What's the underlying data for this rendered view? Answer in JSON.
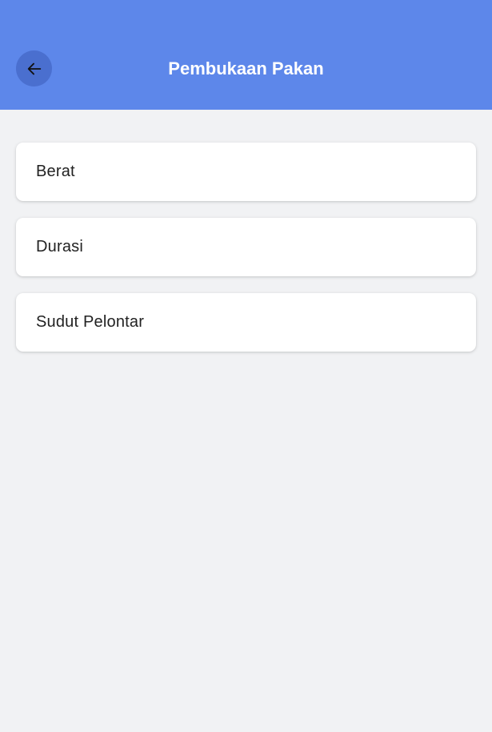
{
  "header": {
    "title": "Pembukaan Pakan",
    "back_icon": "arrow-left-icon",
    "background_color": "#5d87ea",
    "back_button_color": "#4a6fcf"
  },
  "menu": {
    "items": [
      {
        "label": "Berat"
      },
      {
        "label": "Durasi"
      },
      {
        "label": "Sudut Pelontar"
      }
    ]
  },
  "colors": {
    "page_background": "#f1f2f4",
    "card_background": "#ffffff",
    "text": "#222222"
  }
}
